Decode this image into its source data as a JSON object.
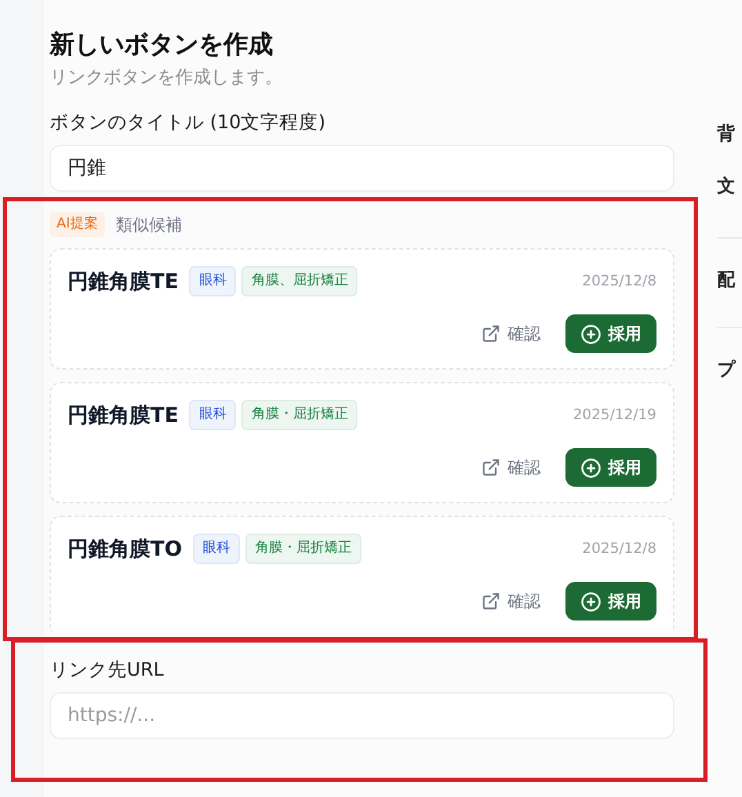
{
  "title": "新しいボタンを作成",
  "subtitle": "リンクボタンを作成します。",
  "title_field": {
    "label": "ボタンのタイトル (10文字程度)",
    "value": "円錐"
  },
  "suggestions": {
    "badge": "AI提案",
    "heading": "類似候補",
    "items": [
      {
        "name": "円錐角膜TE",
        "tags": [
          {
            "label": "眼科",
            "color": "#1d4ed8"
          },
          {
            "label": "角膜、屈折矯正",
            "color": "#15803d"
          }
        ],
        "date": "2025/12/8",
        "check": "確認",
        "adopt": "採用"
      },
      {
        "name": "円錐角膜TE",
        "tags": [
          {
            "label": "眼科",
            "color": "#1d4ed8"
          },
          {
            "label": "角膜・屈折矯正",
            "color": "#15803d"
          }
        ],
        "date": "2025/12/19",
        "check": "確認",
        "adopt": "採用"
      },
      {
        "name": "円錐角膜TO",
        "tags": [
          {
            "label": "眼科",
            "color": "#1d4ed8"
          },
          {
            "label": "角膜・屈折矯正",
            "color": "#15803d"
          }
        ],
        "date": "2025/12/8",
        "check": "確認",
        "adopt": "採用"
      }
    ]
  },
  "url_field": {
    "label": "リンク先URL",
    "placeholder": "https://..."
  },
  "side_labels": [
    "背",
    "文",
    "配",
    "プ"
  ],
  "annotations": [
    {
      "kind": "box"
    },
    {
      "kind": "box"
    }
  ]
}
